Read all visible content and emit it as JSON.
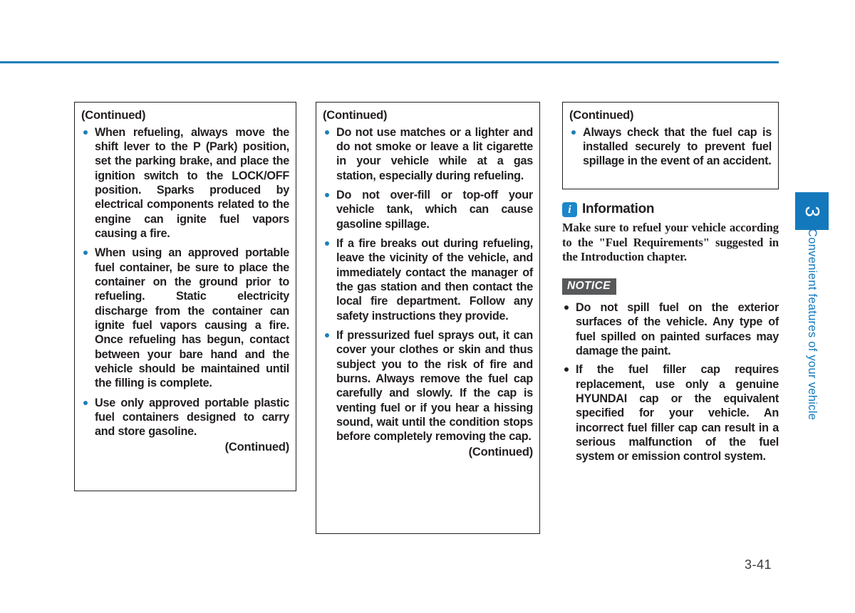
{
  "page": {
    "number": "3-41",
    "accent_color": "#1479bc",
    "rule_color": "#1c7fb8",
    "text_color": "#231f20"
  },
  "chapter_tab": {
    "number": "3",
    "label": "Convenient features of your vehicle"
  },
  "columns": [
    {
      "box": {
        "header": "(Continued)",
        "footer": "(Continued)",
        "bullets": [
          "When refueling, always move the shift lever to the P (Park) position, set the parking brake, and place the ignition switch to the LOCK/OFF position. Sparks produced by electrical components related to the engine can ignite fuel vapors causing a fire.",
          "When using an approved portable fuel container, be sure to place the container on the ground prior to refueling. Static electricity discharge from the container can ignite fuel vapors causing a fire. Once refueling has begun, contact between your bare hand and the vehicle should be maintained until the filling is complete.",
          "Use only approved portable plastic fuel containers designed to carry and store gasoline."
        ]
      }
    },
    {
      "box": {
        "header": "(Continued)",
        "footer": "(Continued)",
        "bullets": [
          "Do not use matches or a lighter and do not smoke or leave a lit cigarette in your vehicle while at a gas station, especially during refueling.",
          "Do not over-fill or top-off your vehicle tank, which can cause gasoline spillage.",
          "If a fire breaks out during refueling, leave the vicinity of the vehicle, and immediately contact the manager of the gas station and then contact the local fire department. Follow any safety instructions they provide.",
          "If pressurized fuel sprays out, it can cover your clothes or skin and thus subject you to the risk of fire and burns. Always remove the fuel cap carefully and slowly. If the cap is venting fuel or if you hear a hissing sound, wait until the condition stops before completely removing the cap."
        ]
      }
    },
    {
      "box": {
        "header": "(Continued)",
        "bullets": [
          "Always check that the fuel cap is installed securely to prevent fuel spillage in the event of an accident."
        ]
      },
      "information": {
        "icon": "info-icon",
        "title": "Information",
        "body": "Make sure to refuel your vehicle according to the \"Fuel Requirements\" suggested in the Introduction chapter."
      },
      "notice": {
        "badge": "NOTICE",
        "bullets": [
          "Do not spill fuel on the exterior surfaces of the vehicle. Any type of fuel spilled on painted surfaces may damage the paint.",
          "If the fuel filler cap requires replacement, use only a genuine HYUNDAI cap or the equivalent specified for your vehicle. An incorrect fuel filler cap can result in a serious malfunction of the fuel system or emission control system."
        ]
      }
    }
  ]
}
